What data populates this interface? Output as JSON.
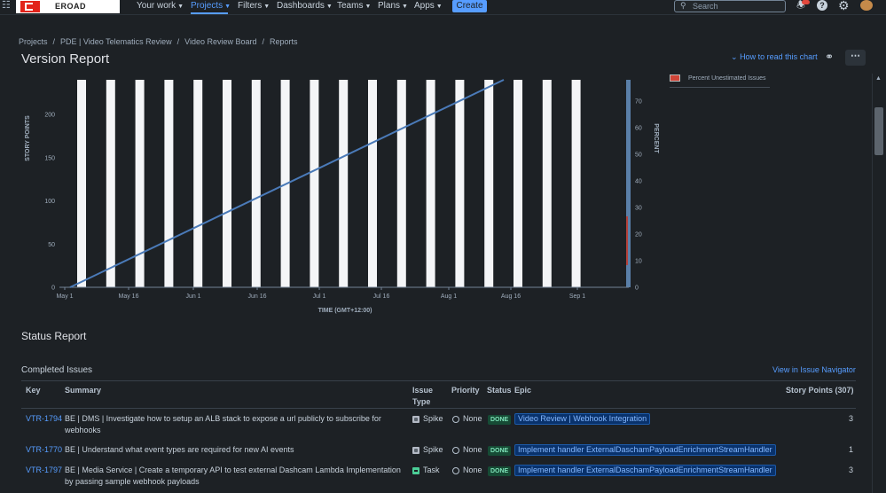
{
  "nav": {
    "logo_text": "EROAD",
    "items": [
      {
        "label": "Your work"
      },
      {
        "label": "Projects"
      },
      {
        "label": "Filters"
      },
      {
        "label": "Dashboards"
      },
      {
        "label": "Teams"
      },
      {
        "label": "Plans"
      },
      {
        "label": "Apps"
      }
    ],
    "create_label": "Create",
    "search_placeholder": "Search"
  },
  "breadcrumb": [
    "Projects",
    "PDE | Video Telematics Review",
    "Video Review Board",
    "Reports"
  ],
  "page_title": "Version Report",
  "how_to_read": "How to read this chart",
  "chart_data": {
    "type": "line",
    "xlabel": "TIME (GMT+12:00)",
    "ylabel": "STORY POINTS",
    "y2label": "PERCENT",
    "x_ticks": [
      "May 1",
      "May 16",
      "Jun 1",
      "Jun 16",
      "Jul 1",
      "Jul 16",
      "Aug 1",
      "Aug 16",
      "Sep 1"
    ],
    "y_ticks": [
      0,
      50,
      100,
      150,
      200
    ],
    "y2_ticks": [
      0,
      10,
      20,
      30,
      40,
      50,
      60,
      70
    ],
    "ylim": [
      0,
      240
    ],
    "y2lim": [
      0,
      78
    ],
    "series": [
      {
        "name": "",
        "x": [
          "May 1",
          "Aug 26"
        ],
        "values": [
          0,
          240
        ]
      }
    ],
    "legend": [
      "Percent Unestimated Issues"
    ],
    "legend_placement": "top-right",
    "weekend_bands": 18
  },
  "status_report": {
    "title": "Status Report",
    "completed_title": "Completed Issues",
    "view_in_navigator": "View in Issue Navigator",
    "headers": {
      "key": "Key",
      "summary": "Summary",
      "issue_type": "Issue Type",
      "priority": "Priority",
      "status": "Status",
      "epic": "Epic",
      "story_points": "Story Points (307)"
    },
    "rows": [
      {
        "key": "VTR-1794",
        "summary": "BE | DMS | Investigate how to setup an ALB stack to expose a url publicly to subscribe for webhooks",
        "type": "Spike",
        "priority": "None",
        "status": "DONE",
        "epic": "Video Review | Webhook Integration",
        "points": "3"
      },
      {
        "key": "VTR-1770",
        "summary": "BE | Understand what event types are required for new AI events",
        "type": "Spike",
        "priority": "None",
        "status": "DONE",
        "epic": "Implement handler ExternalDaschamPayloadEnrichmentStreamHandler",
        "points": "1"
      },
      {
        "key": "VTR-1797",
        "summary": "BE | Media Service | Create a temporary API to test external Dashcam Lambda Implementation by passing sample webhook payloads",
        "type": "Task",
        "priority": "None",
        "status": "DONE",
        "epic": "Implement handler ExternalDaschamPayloadEnrichmentStreamHandler",
        "points": "3"
      }
    ]
  },
  "colors": {
    "background": "#1d2125",
    "link": "#579dff",
    "line": "#4a7ab8",
    "band": "#f4f5f7"
  }
}
